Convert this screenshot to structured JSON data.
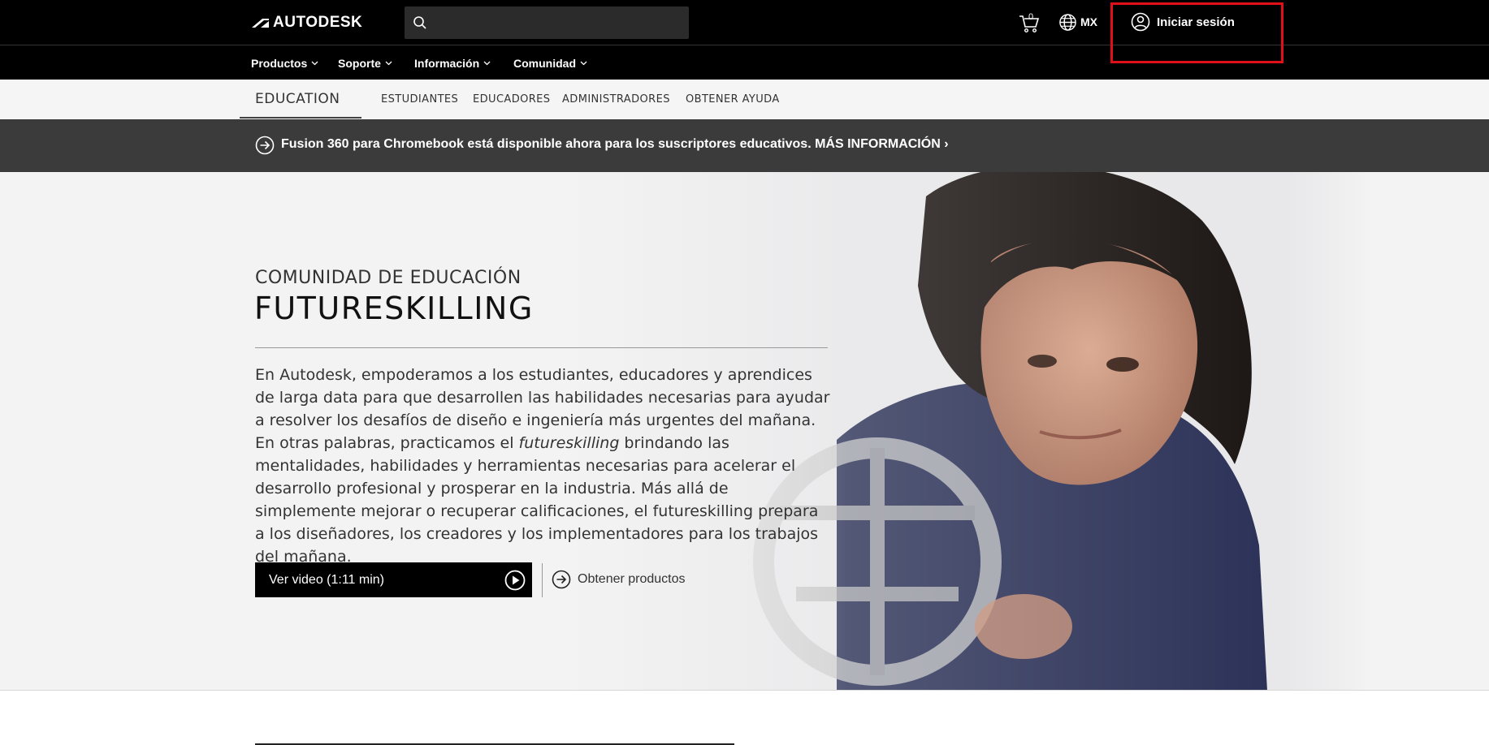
{
  "header": {
    "brand": "AUTODESK",
    "search": {
      "placeholder": ""
    },
    "cart_count": "0",
    "region": "MX",
    "signin_label": "Iniciar sesión"
  },
  "nav": {
    "items": [
      {
        "label": "Productos"
      },
      {
        "label": "Soporte"
      },
      {
        "label": "Información"
      },
      {
        "label": "Comunidad"
      }
    ]
  },
  "subnav": {
    "title": "EDUCATION",
    "items": [
      {
        "label": "ESTUDIANTES"
      },
      {
        "label": "EDUCADORES"
      },
      {
        "label": "ADMINISTRADORES"
      },
      {
        "label": "OBTENER AYUDA"
      }
    ]
  },
  "announcement": {
    "text": "Fusion 360 para Chromebook está disponible ahora para los suscriptores educativos.",
    "link": "MÁS INFORMACIÓN"
  },
  "hero": {
    "kicker": "COMUNIDAD DE EDUCACIÓN",
    "title": "FUTURESKILLING",
    "body_before": "En Autodesk, empoderamos a los estudiantes, educadores y aprendices de larga data para que desarrollen las habilidades necesarias para ayudar a resolver los desafíos de diseño e ingeniería más urgentes del mañana. En otras palabras, practicamos el ",
    "body_italic": "futureskilling",
    "body_after": " brindando las mentalidades, habilidades y herramientas necesarias para acelerar el desarrollo profesional y prosperar en la industria. Más allá de simplemente mejorar o recuperar calificaciones, el futureskilling prepara a los diseñadores, los creadores y los implementadores para los trabajos del mañana.",
    "video_button": "Ver video (1:11 min)",
    "products_link": "Obtener productos"
  },
  "colors": {
    "header_bg": "#000000",
    "announce_bg": "#3b3b3b",
    "hero_bg": "#f3f3f3",
    "highlight": "#e0101b"
  }
}
